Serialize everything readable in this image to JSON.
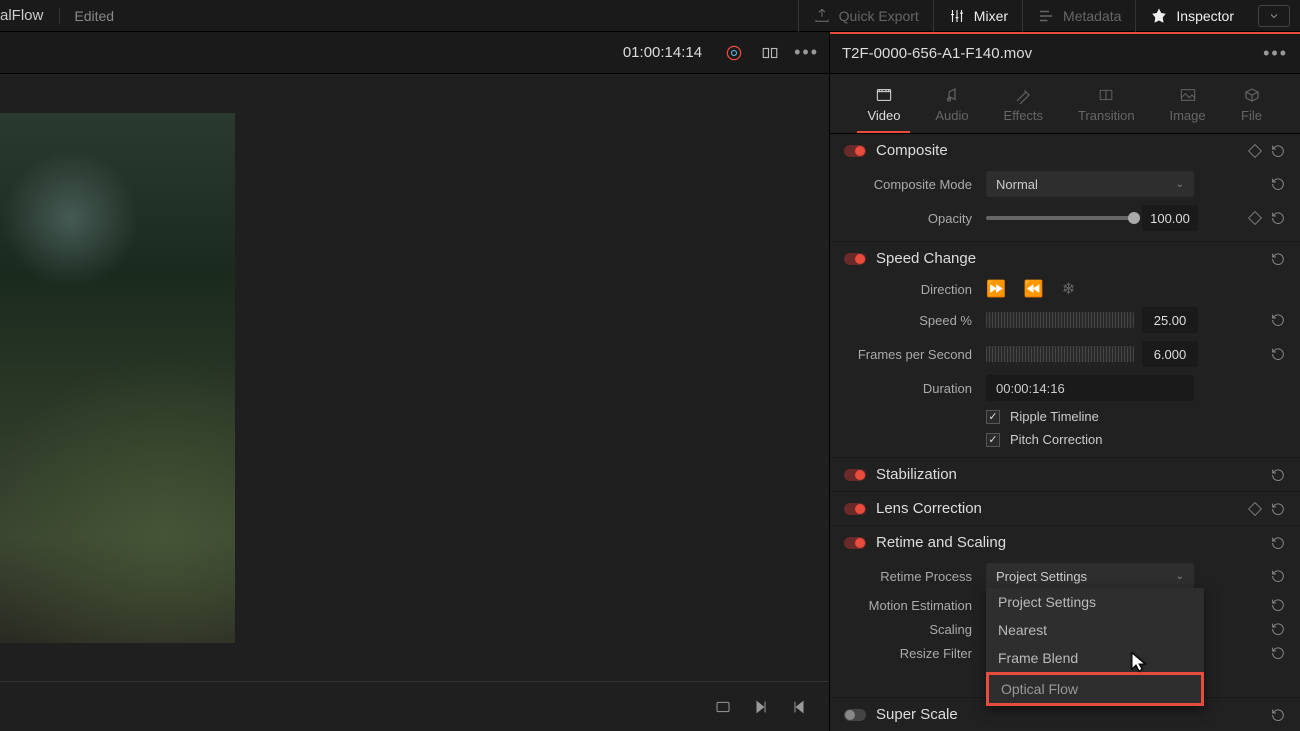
{
  "topbar": {
    "title": "alFlow",
    "edited": "Edited",
    "quick_export": "Quick Export",
    "mixer": "Mixer",
    "metadata": "Metadata",
    "inspector": "Inspector"
  },
  "subhead": {
    "timecode": "01:00:14:14",
    "clip_name": "T2F-0000-656-A1-F140.mov"
  },
  "tabs": {
    "video": "Video",
    "audio": "Audio",
    "effects": "Effects",
    "transition": "Transition",
    "image": "Image",
    "file": "File"
  },
  "composite": {
    "title": "Composite",
    "mode_label": "Composite Mode",
    "mode_value": "Normal",
    "opacity_label": "Opacity",
    "opacity_value": "100.00"
  },
  "speed": {
    "title": "Speed Change",
    "direction_label": "Direction",
    "speed_label": "Speed %",
    "speed_value": "25.00",
    "fps_label": "Frames per Second",
    "fps_value": "6.000",
    "duration_label": "Duration",
    "duration_value": "00:00:14:16",
    "ripple": "Ripple Timeline",
    "pitch": "Pitch Correction"
  },
  "stabilization": {
    "title": "Stabilization"
  },
  "lens": {
    "title": "Lens Correction"
  },
  "retime": {
    "title": "Retime and Scaling",
    "process_label": "Retime Process",
    "process_value": "Project Settings",
    "motion_label": "Motion Estimation",
    "scaling_label": "Scaling",
    "resize_label": "Resize Filter",
    "options": {
      "project": "Project Settings",
      "nearest": "Nearest",
      "frame_blend": "Frame Blend",
      "optical_flow": "Optical Flow"
    }
  },
  "superscale": {
    "title": "Super Scale"
  }
}
